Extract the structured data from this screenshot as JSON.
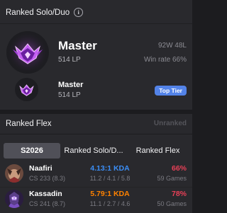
{
  "solo": {
    "title": "Ranked Solo/Duo",
    "info_icon": "i",
    "tier": "Master",
    "lp": "514 LP",
    "record": "92W 48L",
    "winrate": "Win rate 66%",
    "peak": {
      "tier": "Master",
      "lp": "514 LP",
      "badge": "Top Tier"
    }
  },
  "flex": {
    "title": "Ranked Flex",
    "info_icon": "i",
    "status": "Unranked"
  },
  "champions": {
    "tabs": [
      "S2026",
      "Ranked Solo/D...",
      "Ranked Flex"
    ],
    "rows": [
      {
        "name": "Naafiri",
        "cs": "CS 233 (8.3)",
        "kda_ratio": "4.13:1 KDA",
        "kda_color": "#3b8ef6",
        "kda": "11.2 / 4.1 / 5.8",
        "winrate": "66%",
        "winrate_color": "#e84057",
        "games": "59 Games"
      },
      {
        "name": "Kassadin",
        "cs": "CS 241 (8.7)",
        "kda_ratio": "5.79:1 KDA",
        "kda_color": "#ff8200",
        "kda": "11.1 / 2.7 / 4.6",
        "winrate": "78%",
        "winrate_color": "#e84057",
        "games": "50 Games"
      }
    ]
  },
  "colors": {
    "accent": "#5383e8",
    "background": "#1c1c1f",
    "card": "#29292d"
  }
}
